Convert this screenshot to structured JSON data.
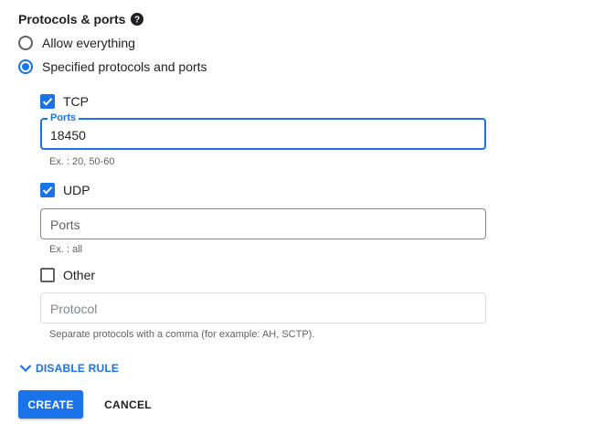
{
  "section": {
    "title": "Protocols & ports",
    "help_icon": "help-circle-icon"
  },
  "radios": [
    {
      "label": "Allow everything",
      "checked": false
    },
    {
      "label": "Specified protocols and ports",
      "checked": true
    }
  ],
  "tcp": {
    "label": "TCP",
    "checked": true,
    "ports_label": "Ports",
    "ports_value": "18450",
    "hint": "Ex. : 20, 50-60"
  },
  "udp": {
    "label": "UDP",
    "checked": true,
    "ports_placeholder": "Ports",
    "hint": "Ex. : all"
  },
  "other": {
    "label": "Other",
    "checked": false,
    "protocol_placeholder": "Protocol",
    "hint": "Separate protocols with a comma (for example: AH, SCTP)."
  },
  "toggle": {
    "label": "DISABLE RULE",
    "icon": "chevron-down-icon"
  },
  "actions": {
    "create_label": "CREATE",
    "cancel_label": "CANCEL"
  },
  "colors": {
    "accent": "#1a73e8",
    "text": "#202124",
    "muted": "#5f6368"
  }
}
